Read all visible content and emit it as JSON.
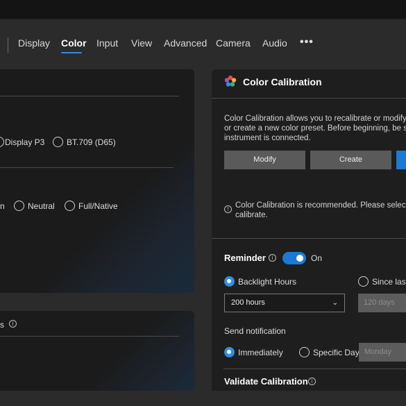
{
  "nav": {
    "tabs": [
      {
        "label": "Display"
      },
      {
        "label": "Color"
      },
      {
        "label": "Input"
      },
      {
        "label": "View"
      },
      {
        "label": "Advanced"
      },
      {
        "label": "Camera"
      },
      {
        "label": "Audio"
      }
    ],
    "active_tab": "Color",
    "more_label": "•••"
  },
  "left": {
    "gamut": {
      "options": [
        "Display P3",
        "BT.709 (D65)"
      ]
    },
    "white_point": {
      "partial_option": "n",
      "options": [
        "Neutral",
        "Full/Native"
      ]
    },
    "bottom_partial_label": "s"
  },
  "calibration": {
    "title": "Color Calibration",
    "description": [
      "Color Calibration allows you to recalibrate or modify cu",
      "or create a new color preset. Before beginning, be sure",
      "instrument is connected."
    ],
    "buttons": {
      "modify": "Modify",
      "create": "Create"
    },
    "notice": [
      "Color Calibration is recommended. Please select the",
      "calibrate."
    ],
    "reminder": {
      "label": "Reminder",
      "toggle_state": "On",
      "options": {
        "backlight": "Backlight Hours",
        "since_last": "Since last"
      },
      "hours_value": "200 hours",
      "days_value": "120 days",
      "send_notification_label": "Send notification",
      "notify_options": {
        "immediately": "Immediately",
        "specific_day": "Specific Day :"
      },
      "day_value": "Monday"
    },
    "validate_label": "Validate Calibration"
  },
  "colors": {
    "accent": "#1a7ad6",
    "panel": "#1e1e1e",
    "background": "#2b2b2b"
  }
}
